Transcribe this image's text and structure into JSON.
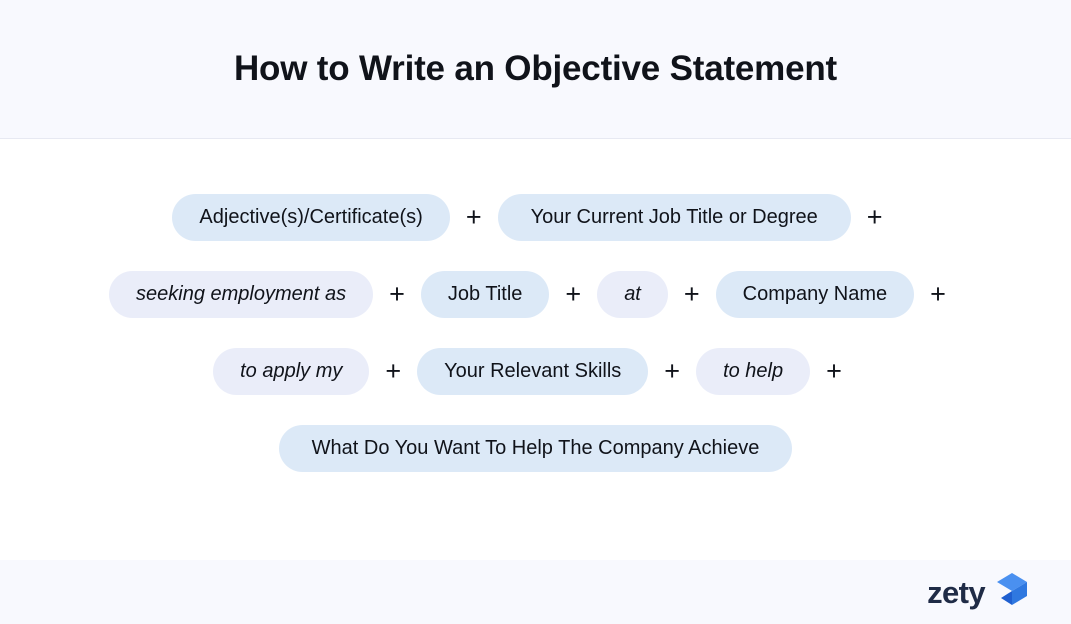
{
  "header": {
    "title": "How to Write an Objective Statement"
  },
  "formula": {
    "plus_symbol": "+",
    "rows": [
      {
        "row_name": "row-1",
        "items": [
          {
            "label": "Adjective(s)/Certificate(s)",
            "style": "solid"
          },
          {
            "label": "+",
            "style": "plus"
          },
          {
            "label": "Your Current Job Title or Degree",
            "style": "solid"
          },
          {
            "label": "+",
            "style": "plus"
          }
        ]
      },
      {
        "row_name": "row-2",
        "items": [
          {
            "label": "seeking employment as",
            "style": "soft"
          },
          {
            "label": "+",
            "style": "plus"
          },
          {
            "label": "Job Title",
            "style": "solid"
          },
          {
            "label": "+",
            "style": "plus"
          },
          {
            "label": "at",
            "style": "soft"
          },
          {
            "label": "+",
            "style": "plus"
          },
          {
            "label": "Company Name",
            "style": "solid"
          },
          {
            "label": "+",
            "style": "plus"
          }
        ]
      },
      {
        "row_name": "row-3",
        "items": [
          {
            "label": "to apply my",
            "style": "soft"
          },
          {
            "label": "+",
            "style": "plus"
          },
          {
            "label": "Your Relevant Skills",
            "style": "solid"
          },
          {
            "label": "+",
            "style": "plus"
          },
          {
            "label": "to help",
            "style": "soft"
          },
          {
            "label": "+",
            "style": "plus"
          }
        ]
      },
      {
        "row_name": "row-4",
        "items": [
          {
            "label": "What Do You Want To Help The Company Achieve",
            "style": "solid"
          }
        ]
      }
    ]
  },
  "footer": {
    "logo_text": "zety",
    "logo_mark_name": "zety-arrow-logo-icon"
  },
  "colors": {
    "header_background": "#f8f9fe",
    "body_background": "#ffffff",
    "footer_background": "#f8f9fe",
    "pill_solid": "#dce9f7",
    "pill_soft": "#eaedf9",
    "text": "#10131a",
    "logo_word": "#1f2b46",
    "logo_mark_light": "#4a90f0",
    "logo_mark_mid": "#3b7fe4",
    "logo_mark_dark": "#1f5fd0"
  }
}
